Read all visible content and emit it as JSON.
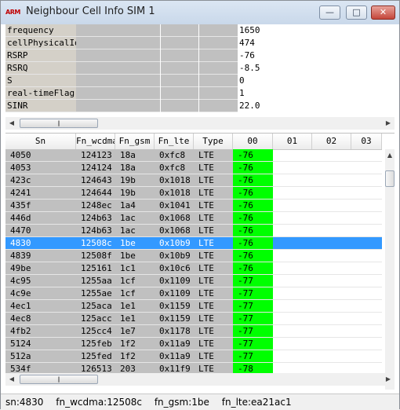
{
  "window": {
    "app_icon_text": "ARM",
    "title": "Neighbour Cell Info SIM 1"
  },
  "info": {
    "rows": [
      {
        "key": "frequency",
        "value": "1650"
      },
      {
        "key": "cellPhysicalId",
        "value": "474"
      },
      {
        "key": "RSRP",
        "value": "-76"
      },
      {
        "key": "RSRQ",
        "value": "-8.5"
      },
      {
        "key": "S",
        "value": "0"
      },
      {
        "key": "real-timeFlag",
        "value": "1"
      },
      {
        "key": "SINR",
        "value": "22.0"
      }
    ]
  },
  "table": {
    "columns": [
      "Sn",
      "Fn_wcdma",
      "Fn_gsm",
      "Fn_lte",
      "Type",
      "00",
      "01",
      "02",
      "03"
    ],
    "rows": [
      {
        "sn": "4050",
        "wcdma": "124123",
        "gsm": "18a",
        "lte": "0xfc8",
        "type": "LTE",
        "v00": "-76"
      },
      {
        "sn": "4053",
        "wcdma": "124124",
        "gsm": "18a",
        "lte": "0xfc8",
        "type": "LTE",
        "v00": "-76"
      },
      {
        "sn": "423c",
        "wcdma": "124643",
        "gsm": "19b",
        "lte": "0x1018",
        "type": "LTE",
        "v00": "-76"
      },
      {
        "sn": "4241",
        "wcdma": "124644",
        "gsm": "19b",
        "lte": "0x1018",
        "type": "LTE",
        "v00": "-76"
      },
      {
        "sn": "435f",
        "wcdma": "1248ec",
        "gsm": "1a4",
        "lte": "0x1041",
        "type": "LTE",
        "v00": "-76"
      },
      {
        "sn": "446d",
        "wcdma": "124b63",
        "gsm": "1ac",
        "lte": "0x1068",
        "type": "LTE",
        "v00": "-76"
      },
      {
        "sn": "4470",
        "wcdma": "124b63",
        "gsm": "1ac",
        "lte": "0x1068",
        "type": "LTE",
        "v00": "-76"
      },
      {
        "sn": "4830",
        "wcdma": "12508c",
        "gsm": "1be",
        "lte": "0x10b9",
        "type": "LTE",
        "v00": "-76"
      },
      {
        "sn": "4839",
        "wcdma": "12508f",
        "gsm": "1be",
        "lte": "0x10b9",
        "type": "LTE",
        "v00": "-76"
      },
      {
        "sn": "49be",
        "wcdma": "125161",
        "gsm": "1c1",
        "lte": "0x10c6",
        "type": "LTE",
        "v00": "-76"
      },
      {
        "sn": "4c95",
        "wcdma": "1255aa",
        "gsm": "1cf",
        "lte": "0x1109",
        "type": "LTE",
        "v00": "-77"
      },
      {
        "sn": "4c9e",
        "wcdma": "1255ae",
        "gsm": "1cf",
        "lte": "0x1109",
        "type": "LTE",
        "v00": "-77"
      },
      {
        "sn": "4ec1",
        "wcdma": "125aca",
        "gsm": "1e1",
        "lte": "0x1159",
        "type": "LTE",
        "v00": "-77"
      },
      {
        "sn": "4ec8",
        "wcdma": "125acc",
        "gsm": "1e1",
        "lte": "0x1159",
        "type": "LTE",
        "v00": "-77"
      },
      {
        "sn": "4fb2",
        "wcdma": "125cc4",
        "gsm": "1e7",
        "lte": "0x1178",
        "type": "LTE",
        "v00": "-77"
      },
      {
        "sn": "5124",
        "wcdma": "125feb",
        "gsm": "1f2",
        "lte": "0x11a9",
        "type": "LTE",
        "v00": "-77"
      },
      {
        "sn": "512a",
        "wcdma": "125fed",
        "gsm": "1f2",
        "lte": "0x11a9",
        "type": "LTE",
        "v00": "-77"
      },
      {
        "sn": "534f",
        "wcdma": "126513",
        "gsm": "203",
        "lte": "0x11f9",
        "type": "LTE",
        "v00": "-78"
      }
    ],
    "selected_sn": "4830"
  },
  "status": {
    "sn": "sn:4830",
    "wcdma": "fn_wcdma:12508c",
    "gsm": "fn_gsm:1be",
    "lte": "fn_lte:ea21ac1"
  },
  "colors": {
    "signal_cell": "#00ff00",
    "selection": "#3399ff",
    "gray_cell": "#c0c0c0"
  }
}
